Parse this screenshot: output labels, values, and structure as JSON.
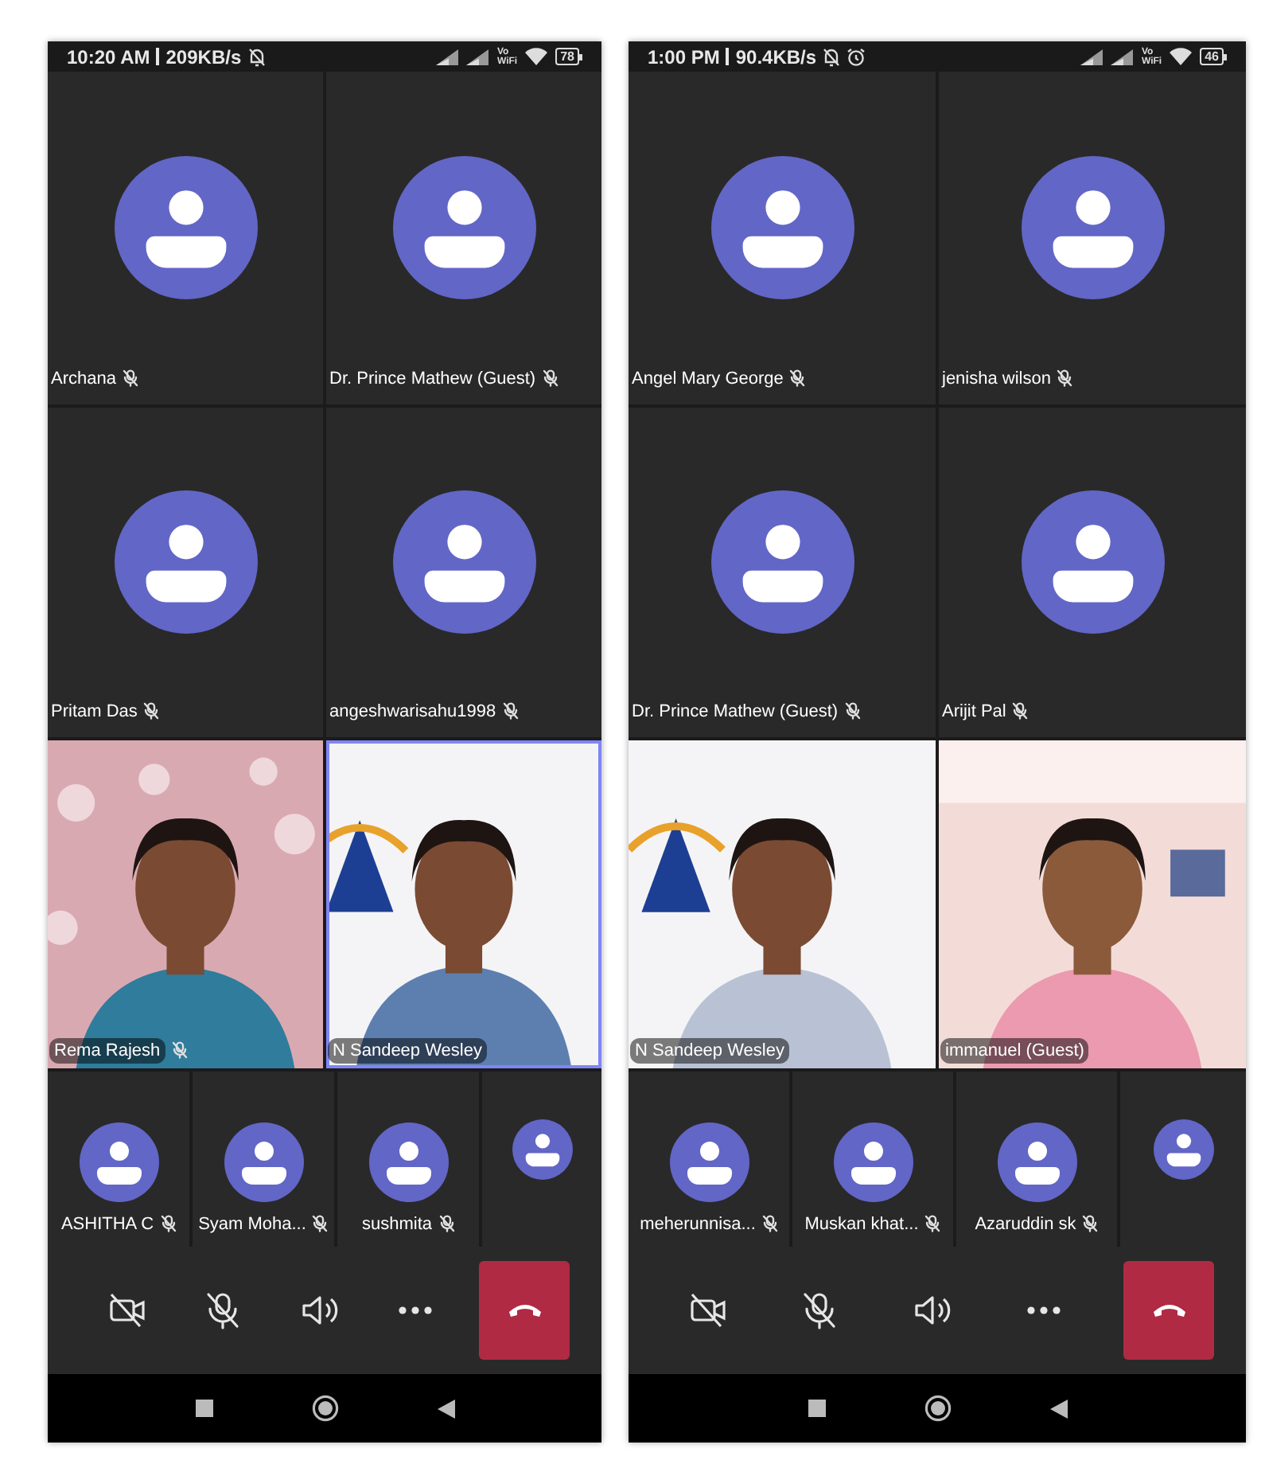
{
  "phones": [
    {
      "status_bar": {
        "time": "10:20 AM",
        "speed": "209KB/s",
        "alarm": false,
        "vowifi": [
          "Vo",
          "WiFi"
        ],
        "battery": "78"
      },
      "tiles": [
        {
          "name": "Archana",
          "muted": true
        },
        {
          "name": "Dr. Prince Mathew (Guest)",
          "muted": true
        },
        {
          "name": "Pritam Das",
          "muted": true
        },
        {
          "name": "angeshwarisahu1998",
          "muted": true
        }
      ],
      "video_tiles": [
        {
          "kind": "picture",
          "name": "Rema Rajesh",
          "muted": true,
          "active": false
        },
        {
          "kind": "picture",
          "name": "N Sandeep Wesley",
          "muted": false,
          "active": true
        }
      ],
      "strip": [
        {
          "kind": "named",
          "name": "ASHITHA C",
          "muted": true
        },
        {
          "kind": "named",
          "name": "Syam Moha...",
          "muted": true
        },
        {
          "kind": "named",
          "name": "sushmita",
          "muted": true
        },
        {
          "kind": "partial"
        }
      ]
    },
    {
      "status_bar": {
        "time": "1:00 PM",
        "speed": "90.4KB/s",
        "alarm": true,
        "vowifi": [
          "Vo",
          "WiFi"
        ],
        "battery": "46"
      },
      "tiles": [
        {
          "name": "Angel Mary George",
          "muted": true
        },
        {
          "name": "jenisha wilson",
          "muted": true
        },
        {
          "name": "Dr. Prince Mathew (Guest)",
          "muted": true
        },
        {
          "name": "Arijit Pal",
          "muted": true
        }
      ],
      "video_tiles": [
        {
          "kind": "picture",
          "name": "N Sandeep Wesley",
          "muted": false,
          "active": false
        },
        {
          "kind": "picture",
          "name": "immanuel (Guest)",
          "muted": false,
          "active": false
        }
      ],
      "strip": [
        {
          "kind": "named",
          "name": "meherunnisa...",
          "muted": true
        },
        {
          "kind": "named",
          "name": "Muskan khat...",
          "muted": true
        },
        {
          "kind": "named",
          "name": "Azaruddin sk",
          "muted": true
        },
        {
          "kind": "partial"
        }
      ]
    }
  ]
}
